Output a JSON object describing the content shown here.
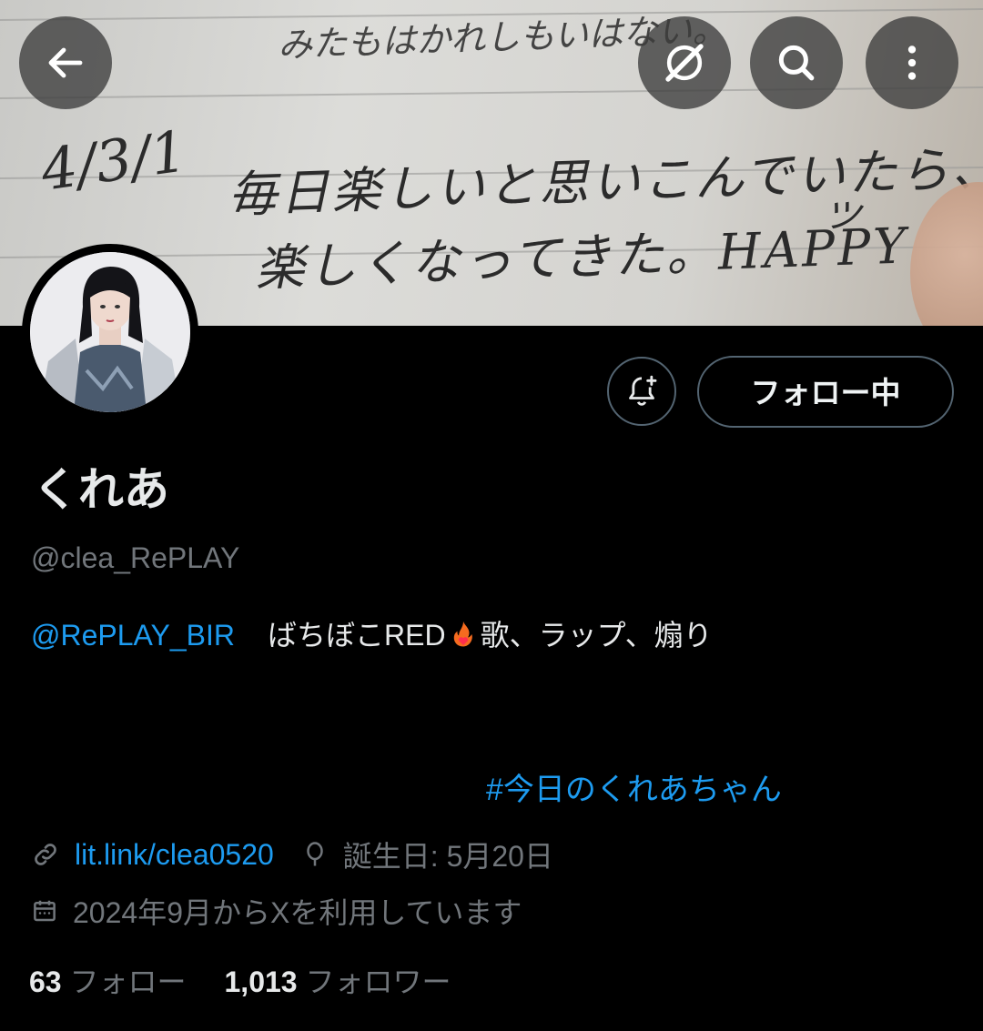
{
  "banner": {
    "note_lines": [
      "みたもはかれしもいはない。",
      "毎日楽しいと思いこんでいたら、",
      "楽しくなってきた。HAPPY",
      "4/3/1",
      "ツ"
    ]
  },
  "top_bar": {
    "back_icon": "arrow-left-icon",
    "grok_icon": "grok-icon",
    "search_icon": "search-icon",
    "more_icon": "more-vertical-icon"
  },
  "actions": {
    "notify_icon": "bell-plus-icon",
    "follow_label": "フォロー中"
  },
  "profile": {
    "display_name": "くれあ",
    "handle": "@clea_RePLAY",
    "bio_mention": "@RePLAY_BIR",
    "bio_text_before_emoji": "ばちぼこRED",
    "bio_emoji": "fire-heart-icon",
    "bio_text_after_emoji": "歌、ラップ、煽り",
    "hashtag": "#今日のくれあちゃん",
    "website": "lit.link/clea0520",
    "birthday": "誕生日: 5月20日",
    "joined": "2024年9月からXを利用しています"
  },
  "stats": {
    "following_count": "63",
    "following_label": "フォロー",
    "followers_count": "1,013",
    "followers_label": "フォロワー"
  },
  "colors": {
    "background": "#000000",
    "link": "#1d9bf0",
    "muted": "#71767b",
    "text": "#e7e9ea",
    "border": "#536471"
  }
}
